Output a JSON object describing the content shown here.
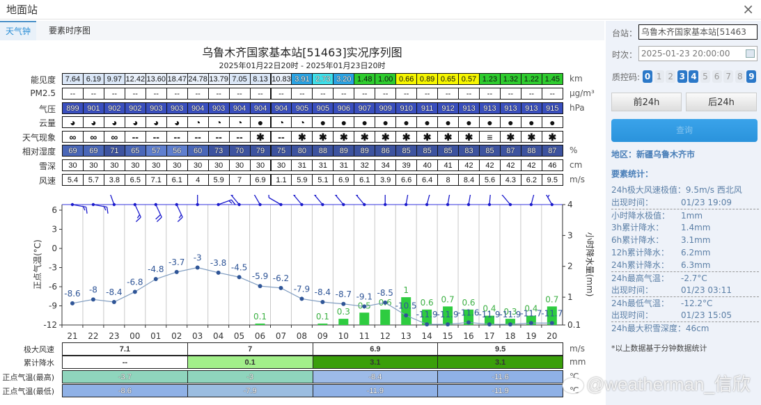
{
  "window": {
    "title": "地面站",
    "close_icon": "×"
  },
  "tabs": [
    {
      "label": "天气钟",
      "active": true
    },
    {
      "label": "要素时序图",
      "active": false
    }
  ],
  "chart_title": "乌鲁木齐国家基本站[51463]实况序列图",
  "chart_subtitle": "2025年01月22日20时 - 2025年01月23日20时",
  "hours": [
    "21",
    "22",
    "23",
    "00",
    "01",
    "02",
    "03",
    "04",
    "05",
    "06",
    "07",
    "08",
    "09",
    "10",
    "11",
    "12",
    "13",
    "14",
    "15",
    "16",
    "17",
    "18",
    "19",
    "20"
  ],
  "rows": [
    {
      "label": "能见度",
      "unit": "km",
      "values": [
        "7.64",
        "6.19",
        "9.97",
        "12.42",
        "13.60",
        "18.47",
        "24.78",
        "13.79",
        "7.05",
        "8.13",
        "10.83",
        "3.91",
        "2.73",
        "3.20",
        "1.48",
        "1.00",
        "0.66",
        "0.89",
        "0.65",
        "0.57",
        "1.23",
        "1.32",
        "1.22",
        "1.45"
      ]
    },
    {
      "label": "PM2.5",
      "unit": "μg/m³",
      "values": [
        "--",
        "--",
        "--",
        "--",
        "--",
        "--",
        "--",
        "--",
        "--",
        "--",
        "--",
        "--",
        "--",
        "--",
        "--",
        "--",
        "--",
        "--",
        "--",
        "--",
        "--",
        "--",
        "--",
        "--"
      ]
    },
    {
      "label": "气压",
      "unit": "hPa",
      "values": [
        "899",
        "901",
        "902",
        "902",
        "903",
        "903",
        "904",
        "903",
        "904",
        "904",
        "904",
        "905",
        "905",
        "906",
        "907",
        "909",
        "910",
        "911",
        "912",
        "913",
        "913",
        "913",
        "913",
        "915"
      ]
    },
    {
      "label": "云量",
      "unit": "",
      "values": [
        "◕",
        "◕",
        "◕",
        "◕",
        "◕",
        "◕",
        "◔",
        "◔",
        "◔",
        "●",
        "◔",
        "◔",
        "●",
        "●",
        "●",
        "●",
        "●",
        "●",
        "●",
        "●",
        "●",
        "●",
        "●",
        "●"
      ]
    },
    {
      "label": "天气现象",
      "unit": "",
      "values": [
        "∞",
        "∞",
        "∞",
        "--",
        "--",
        "--",
        "--",
        "--",
        "--",
        "✱",
        "--",
        "✱",
        "✱",
        "✱",
        "✱",
        "✱",
        "✱",
        "✱",
        "✱",
        "✱",
        "≡",
        "✱",
        "✱",
        "✱"
      ]
    },
    {
      "label": "相对湿度",
      "unit": "%",
      "values": [
        "69",
        "69",
        "71",
        "65",
        "57",
        "56",
        "60",
        "73",
        "70",
        "79",
        "75",
        "80",
        "88",
        "89",
        "89",
        "86",
        "85",
        "85",
        "85",
        "83",
        "85",
        "87",
        "88",
        "87"
      ]
    },
    {
      "label": "雪深",
      "unit": "cm",
      "values": [
        "30",
        "30",
        "30",
        "30",
        "30",
        "30",
        "30",
        "30",
        "30",
        "30",
        "30",
        "31",
        "31",
        "31",
        "32",
        "34",
        "39",
        "40",
        "41",
        "42",
        "42",
        "42",
        "42",
        "46"
      ]
    },
    {
      "label": "风速",
      "unit": "m/s",
      "values": [
        "5.4",
        "5.7",
        "3.8",
        "6.5",
        "7.1",
        "6.1",
        "4",
        "5.9",
        "7",
        "6.9",
        "1.1",
        "5.9",
        "5.1",
        "6.9",
        "6.1",
        "3.9",
        "6.6",
        "6.4",
        "8",
        "8.4",
        "5.6",
        "4.3",
        "6.2",
        "9.5"
      ]
    }
  ],
  "chart_data": {
    "type": "line+bar",
    "categories": [
      "21",
      "22",
      "23",
      "00",
      "01",
      "02",
      "03",
      "04",
      "05",
      "06",
      "07",
      "08",
      "09",
      "10",
      "11",
      "12",
      "13",
      "14",
      "15",
      "16",
      "17",
      "18",
      "19",
      "20"
    ],
    "ylabel_left": "正点气温(°C)",
    "ylabel_right": "小时降水量(mm)",
    "yticks_left": [
      "6",
      "3",
      "0",
      "-3",
      "-6",
      "-9",
      "-12"
    ],
    "ylim_left": [
      -12,
      6
    ],
    "yticks_right": [
      "4",
      "3",
      "2",
      "1",
      "0.1"
    ],
    "ylim_right": [
      0.1,
      4
    ],
    "grid": "vertical",
    "temperature": [
      -8.6,
      -8,
      -8.4,
      -6.8,
      -4.8,
      -3.7,
      -3,
      -3.8,
      -4.5,
      -5.9,
      -6.2,
      -7.9,
      -8.4,
      -8.7,
      -9.1,
      -8.5,
      -10.5,
      -11.9,
      -11.9,
      -11.6,
      -11.9,
      -11.9,
      -11.7,
      -11.7
    ],
    "precipitation": [
      null,
      null,
      null,
      null,
      null,
      null,
      null,
      null,
      null,
      0.1,
      null,
      null,
      0.1,
      0.3,
      0.5,
      0.6,
      1,
      0.6,
      0.7,
      0.6,
      0.4,
      0.3,
      0.4,
      0.7
    ],
    "wind_speed": [
      5.4,
      5.7,
      3.8,
      6.5,
      7.1,
      6.1,
      4,
      5.9,
      7,
      6.9,
      1.1,
      5.9,
      5.1,
      6.9,
      6.1,
      3.9,
      6.6,
      6.4,
      8,
      8.4,
      5.6,
      4.3,
      6.2,
      9.5
    ],
    "wind_direction_deg": [
      100,
      100,
      340,
      155,
      155,
      155,
      0,
      70,
      320,
      330,
      300,
      320,
      320,
      320,
      320,
      0,
      10,
      15,
      10,
      10,
      5,
      320,
      15,
      330
    ],
    "colors": {
      "temperature": "#2f5597",
      "temp_line": "#7f9cc0",
      "precip": "#2ecc40",
      "precip_label": "#3cb043",
      "wind": "#1a1acc"
    }
  },
  "summary": {
    "headers": [
      "极大风速",
      "累计降水",
      "正点气温(最高)",
      "正点气温(最低)"
    ],
    "units": [
      "m/s",
      "mm",
      "℃",
      "℃"
    ],
    "rows": [
      [
        "7.1",
        "7",
        "6.9",
        "9.5"
      ],
      [
        "--",
        "0.1",
        "3.1",
        "3.1"
      ],
      [
        "-3.7",
        "-3",
        "-8.4",
        "-11.6"
      ],
      [
        "-8.6",
        "-7.9",
        "-11.9",
        "-11.9"
      ]
    ]
  },
  "side": {
    "station_label": "台站：",
    "station_value": "乌鲁木齐国家基本站[51463",
    "time_label": "时次：",
    "time_value": "2025-01-23 20:00:00",
    "qc_label": "质控码:",
    "qc_codes": [
      {
        "c": "0",
        "on": true
      },
      {
        "c": "1",
        "on": false
      },
      {
        "c": "2",
        "on": false
      },
      {
        "c": "3",
        "on": true
      },
      {
        "c": "4",
        "on": true
      },
      {
        "c": "5",
        "on": false
      },
      {
        "c": "6",
        "on": false
      },
      {
        "c": "7",
        "on": false
      },
      {
        "c": "8",
        "on": false
      },
      {
        "c": "9",
        "on": true
      }
    ],
    "prev_btn": "前24h",
    "next_btn": "后24h",
    "query_btn": "查询",
    "region": "地区：新疆乌鲁木齐市",
    "stats_title": "要素统计：",
    "stats": [
      {
        "k": "24h极大风速极值：",
        "v": "9.5m/s 西北风",
        "dash": false
      },
      {
        "k": "出现时间：",
        "v": "01/23 19:09",
        "dash": false
      },
      {
        "k": "小时降水极值：",
        "v": "1mm",
        "dash": true
      },
      {
        "k": "3h累计降水：",
        "v": "1.4mm",
        "dash": false
      },
      {
        "k": "6h累计降水：",
        "v": "3.1mm",
        "dash": false
      },
      {
        "k": "12h累计降水：",
        "v": "6.2mm",
        "dash": false
      },
      {
        "k": "24h累计降水：",
        "v": "6.3mm",
        "dash": false
      },
      {
        "k": "24h最高气温：",
        "v": "-2.7°C",
        "dash": true
      },
      {
        "k": "出现时间：",
        "v": "01/23 03:11",
        "dash": false
      },
      {
        "k": "24h最低气温：",
        "v": "-12.2°C",
        "dash": true
      },
      {
        "k": "出现时间：",
        "v": "01/23 15:05",
        "dash": false
      },
      {
        "k": "24h最大积雪深度：",
        "v": "46cm",
        "dash": true
      }
    ],
    "footnote": "*以上数据基于分钟数据统计"
  },
  "watermark": "@weatherman_信欣"
}
